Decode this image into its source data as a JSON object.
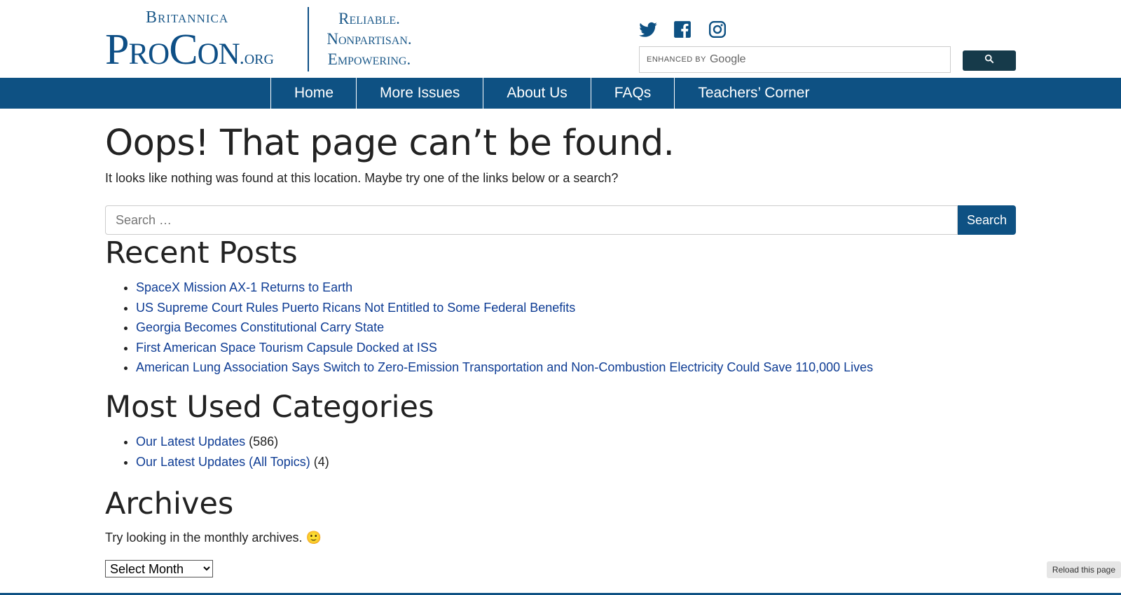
{
  "logo": {
    "brand_top": "Britannica",
    "brand_main": "ProCon",
    "brand_suffix": ".org",
    "tagline_1": "Reliable.",
    "tagline_2": "Nonpartisan.",
    "tagline_3": "Empowering."
  },
  "social": [
    "twitter-icon",
    "facebook-icon",
    "instagram-icon"
  ],
  "google_search": {
    "enhanced": "ENHANCED BY",
    "google": "Google"
  },
  "nav": [
    "Home",
    "More Issues",
    "About Us",
    "FAQs",
    "Teachers’ Corner"
  ],
  "page": {
    "title": "Oops! That page can’t be found.",
    "intro": "It looks like nothing was found at this location. Maybe try one of the links below or a search?",
    "search_placeholder": "Search …",
    "search_button": "Search"
  },
  "recent_posts": {
    "heading": "Recent Posts",
    "items": [
      "SpaceX Mission AX-1 Returns to Earth",
      "US Supreme Court Rules Puerto Ricans Not Entitled to Some Federal Benefits",
      "Georgia Becomes Constitutional Carry State",
      "First American Space Tourism Capsule Docked at ISS",
      "American Lung Association Says Switch to Zero-Emission Transportation and Non-Combustion Electricity Could Save 110,000 Lives"
    ]
  },
  "categories": {
    "heading": "Most Used Categories",
    "items": [
      {
        "label": "Our Latest Updates",
        "count": "(586)"
      },
      {
        "label": "Our Latest Updates (All Topics)",
        "count": "(4)"
      }
    ]
  },
  "archives": {
    "heading": "Archives",
    "text": "Try looking in the monthly archives. 🙂",
    "select": "Select Month"
  },
  "reload": "Reload this page",
  "colors": {
    "primary": "#0e5183",
    "link": "#0e3c94",
    "logo": "#0e4f86"
  }
}
